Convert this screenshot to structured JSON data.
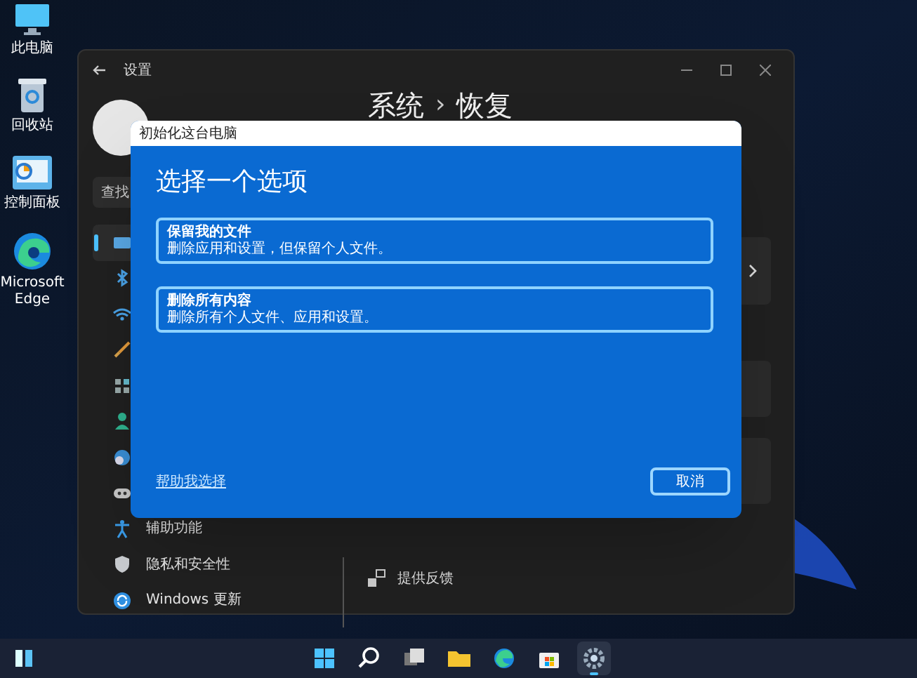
{
  "desktop_icons": [
    {
      "kind": "computer",
      "label": "此电脑"
    },
    {
      "kind": "recycle",
      "label": "回收站"
    },
    {
      "kind": "control",
      "label": "控制面板"
    },
    {
      "kind": "edge",
      "label": "Microsoft Edge"
    }
  ],
  "settings_window": {
    "title": "设置",
    "breadcrumb": [
      "系统",
      "恢复"
    ],
    "breadcrumb_separator": "›",
    "search": {
      "placeholder": "查找"
    },
    "sidebar_items": [
      {
        "kind": "display",
        "selected": true
      },
      {
        "kind": "bluetooth",
        "selected": false
      },
      {
        "kind": "wifi",
        "selected": false
      },
      {
        "kind": "brush",
        "selected": false
      },
      {
        "kind": "apps",
        "selected": false
      },
      {
        "kind": "person",
        "selected": false
      },
      {
        "kind": "globe",
        "selected": false
      },
      {
        "kind": "gamepad",
        "selected": false
      },
      {
        "kind": "accessibility",
        "label": "辅助功能",
        "selected": false
      },
      {
        "kind": "shield",
        "label": "隐私和安全性",
        "selected": false
      },
      {
        "kind": "update",
        "label": "Windows 更新",
        "selected": false
      }
    ],
    "feedback_link": "提供反馈"
  },
  "dialog": {
    "title": "初始化这台电脑",
    "heading": "选择一个选项",
    "options": [
      {
        "title": "保留我的文件",
        "description": "删除应用和设置，但保留个人文件。"
      },
      {
        "title": "删除所有内容",
        "description": "删除所有个人文件、应用和设置。"
      }
    ],
    "help_link": "帮助我选择",
    "cancel_button": "取消"
  },
  "taskbar": {
    "items": [
      {
        "kind": "start",
        "selected": false
      },
      {
        "kind": "search",
        "selected": false
      },
      {
        "kind": "taskview",
        "selected": false
      },
      {
        "kind": "folder",
        "selected": false
      },
      {
        "kind": "edge",
        "selected": false
      },
      {
        "kind": "store",
        "selected": false
      },
      {
        "kind": "settings",
        "selected": true
      }
    ]
  }
}
